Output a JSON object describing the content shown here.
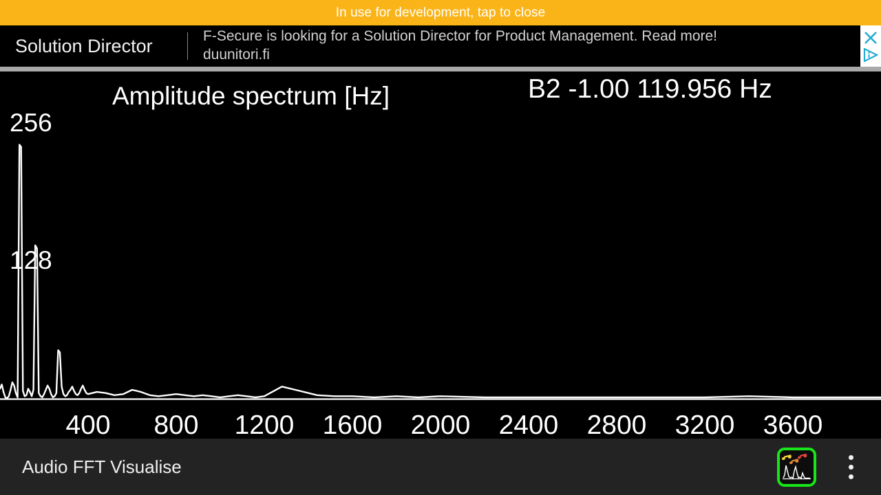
{
  "dev_bar": {
    "message": "In use for development, tap to close"
  },
  "ad": {
    "advertiser": "Solution Director",
    "body": "F-Secure is looking for a Solution Director for Product Management. Read more! duunitori.fi",
    "close_icon": "close-icon",
    "choices_icon": "ad-choices-icon",
    "close_color": "#27ADD4",
    "background": "#000000"
  },
  "plot": {
    "title": "Amplitude spectrum [Hz]",
    "readout": "B2 -1.00 119.956 Hz",
    "trace_color": "#FFFFFF",
    "background": "#000000"
  },
  "toolbar": {
    "app_title": "Audio FFT Visualise",
    "app_icon": "audio-fft-visualise-app-icon",
    "overflow_icon": "overflow-menu-icon",
    "accent": "#19E619",
    "background": "#232323"
  },
  "chart_data": {
    "type": "line",
    "title": "Amplitude spectrum [Hz]",
    "xlabel": "",
    "ylabel": "",
    "grid": false,
    "legend": null,
    "annotation": "B2 -1.00 119.956 Hz",
    "xlim": [
      0,
      4000
    ],
    "ylim": [
      0,
      300
    ],
    "xticks": [
      400,
      800,
      1200,
      1600,
      2000,
      2400,
      2800,
      3200,
      3600
    ],
    "xtick_labels": [
      "400",
      "800",
      "1200",
      "1600",
      "2000",
      "2400",
      "2800",
      "3200",
      "3600"
    ],
    "yticks": [
      128,
      256
    ],
    "ytick_labels": [
      "128",
      "256"
    ],
    "series": [
      {
        "name": "amplitude",
        "x": [
          0,
          8,
          16,
          24,
          32,
          40,
          48,
          56,
          64,
          72,
          80,
          88,
          96,
          104,
          112,
          120,
          128,
          136,
          144,
          152,
          160,
          168,
          176,
          184,
          192,
          200,
          208,
          216,
          224,
          232,
          240,
          248,
          256,
          264,
          272,
          280,
          288,
          296,
          304,
          312,
          320,
          328,
          336,
          344,
          352,
          360,
          368,
          376,
          384,
          392,
          400,
          440,
          480,
          520,
          560,
          600,
          640,
          680,
          720,
          760,
          800,
          840,
          880,
          920,
          960,
          1000,
          1040,
          1080,
          1120,
          1160,
          1200,
          1280,
          1360,
          1440,
          1520,
          1600,
          1700,
          1800,
          1900,
          2000,
          2200,
          2400,
          2600,
          2800,
          3000,
          3200,
          3400,
          3600,
          3800,
          4000
        ],
        "y": [
          10,
          14,
          7,
          2,
          1,
          3,
          9,
          16,
          13,
          6,
          2,
          238,
          236,
          8,
          3,
          4,
          10,
          7,
          3,
          9,
          144,
          141,
          6,
          3,
          2,
          5,
          9,
          13,
          10,
          5,
          2,
          3,
          6,
          46,
          44,
          12,
          5,
          3,
          4,
          7,
          9,
          12,
          8,
          5,
          4,
          6,
          10,
          13,
          9,
          6,
          5,
          7,
          6,
          4,
          5,
          9,
          7,
          4,
          3,
          4,
          5,
          4,
          3,
          4,
          3,
          2,
          3,
          4,
          3,
          2,
          3,
          12,
          8,
          4,
          3,
          3,
          2,
          3,
          2,
          3,
          2,
          2,
          2,
          2,
          2,
          2,
          3,
          2,
          2,
          2
        ]
      }
    ],
    "peaks": [
      {
        "frequency": 120,
        "amplitude": 238,
        "note": "B2"
      },
      {
        "frequency": 240,
        "amplitude": 144
      },
      {
        "frequency": 360,
        "amplitude": 46
      }
    ]
  }
}
